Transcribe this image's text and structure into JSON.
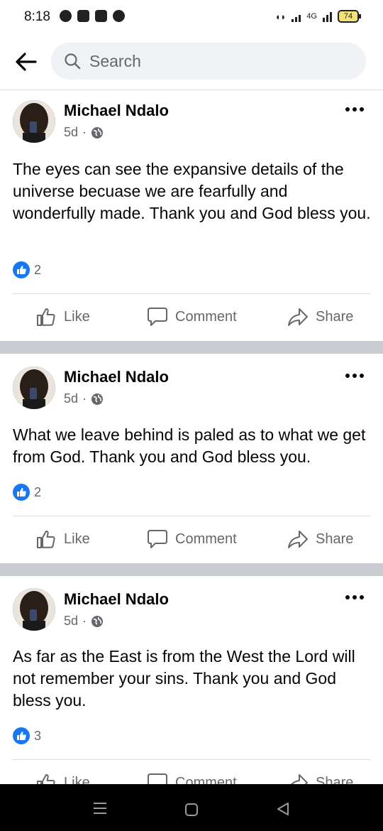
{
  "status_bar": {
    "time": "8:18",
    "network": "4G",
    "battery": "74"
  },
  "search": {
    "placeholder": "Search"
  },
  "posts": [
    {
      "author": "Michael Ndalo",
      "time": "5d",
      "text": "The eyes can see the expansive details of the universe becuase we are fearfully and wonderfully made. Thank you and God bless you.",
      "likes": "2",
      "actions": {
        "like": "Like",
        "comment": "Comment",
        "share": "Share"
      }
    },
    {
      "author": "Michael Ndalo",
      "time": "5d",
      "text": "What we leave behind is paled as to what we get from God. Thank you and God bless you.",
      "likes": "2",
      "actions": {
        "like": "Like",
        "comment": "Comment",
        "share": "Share"
      }
    },
    {
      "author": "Michael Ndalo",
      "time": "5d",
      "text": "As far as the East is from the West the Lord will not remember your sins.  Thank you and God bless you.",
      "likes": "3",
      "actions": {
        "like": "Like",
        "comment": "Comment",
        "share": "Share"
      }
    }
  ],
  "colors": {
    "accent": "#1877f2",
    "separator": "#c9ccd1",
    "muted": "#65676b"
  },
  "icons": [
    "back-arrow-icon",
    "search-icon",
    "globe-icon",
    "more-icon",
    "like-icon",
    "comment-icon",
    "share-icon"
  ]
}
